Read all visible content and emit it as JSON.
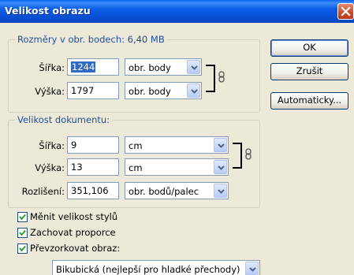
{
  "window": {
    "title": "Velikost obrazu"
  },
  "pixel_dimensions": {
    "legend": "Rozměry v obr. bodech: 6,40 MB",
    "width_label": "Šířka:",
    "width_value": "1244",
    "width_unit": "obr. body",
    "height_label": "Výška:",
    "height_value": "1797",
    "height_unit": "obr. body"
  },
  "document_size": {
    "legend": "Velikost dokumentu:",
    "width_label": "Šířka:",
    "width_value": "9",
    "width_unit": "cm",
    "height_label": "Výška:",
    "height_value": "13",
    "height_unit": "cm",
    "resolution_label": "Rozlišení:",
    "resolution_value": "351,106",
    "resolution_unit": "obr. bodů/palec"
  },
  "buttons": {
    "ok": "OK",
    "cancel": "Zrušit",
    "auto": "Automaticky..."
  },
  "options": {
    "scale_styles": {
      "label": "Měnit velikost stylů",
      "checked": true
    },
    "constrain": {
      "label": "Zachovat proporce",
      "checked": true
    },
    "resample": {
      "label": "Převzorkovat obraz:",
      "checked": true
    },
    "resample_method": "Bikubická (nejlepší pro hladké přechody)"
  },
  "icons": {
    "link": "chain-link-icon",
    "close": "close-icon",
    "dropdown": "chevron-down-icon",
    "check": "checkmark-icon"
  },
  "colors": {
    "title_bar": "#0A5FEB",
    "legend_text": "#1F4E9A",
    "selection": "#316AC5",
    "close_button": "#C94A2A"
  }
}
